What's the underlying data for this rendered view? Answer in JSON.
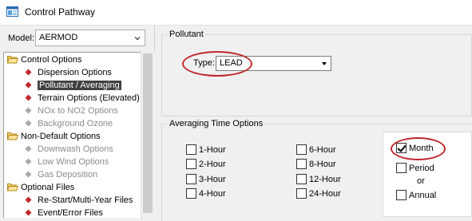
{
  "window": {
    "title": "Control Pathway",
    "icon": "app-window-icon"
  },
  "sidebar": {
    "model_label": "Model:",
    "model_value": "AERMOD",
    "tree": [
      {
        "label": "Control Options",
        "kind": "folder",
        "state": "normal"
      },
      {
        "label": "Dispersion Options",
        "kind": "item",
        "state": "normal"
      },
      {
        "label": "Pollutant / Averaging",
        "kind": "item",
        "state": "selected"
      },
      {
        "label": "Terrain Options (Elevated)",
        "kind": "item",
        "state": "normal"
      },
      {
        "label": "NOx to NO2 Options",
        "kind": "item",
        "state": "disabled"
      },
      {
        "label": "Background Ozone",
        "kind": "item",
        "state": "disabled"
      },
      {
        "label": "Non-Default Options",
        "kind": "folder",
        "state": "normal"
      },
      {
        "label": "Downwash Options",
        "kind": "item",
        "state": "disabled"
      },
      {
        "label": "Low Wind Options",
        "kind": "item",
        "state": "disabled"
      },
      {
        "label": "Gas Deposition",
        "kind": "item",
        "state": "disabled"
      },
      {
        "label": "Optional Files",
        "kind": "folder",
        "state": "normal"
      },
      {
        "label": "Re-Start/Multi-Year Files",
        "kind": "item",
        "state": "normal"
      },
      {
        "label": "Event/Error Files",
        "kind": "item",
        "state": "normal"
      }
    ]
  },
  "pollutant": {
    "group_title": "Pollutant",
    "type_label": "Type:",
    "type_value": "LEAD"
  },
  "averaging": {
    "group_title": "Averaging Time Options",
    "options": [
      {
        "label": "1-Hour",
        "checked": false
      },
      {
        "label": "2-Hour",
        "checked": false
      },
      {
        "label": "3-Hour",
        "checked": false
      },
      {
        "label": "4-Hour",
        "checked": false
      },
      {
        "label": "6-Hour",
        "checked": false
      },
      {
        "label": "8-Hour",
        "checked": false
      },
      {
        "label": "12-Hour",
        "checked": false
      },
      {
        "label": "24-Hour",
        "checked": false
      }
    ],
    "month": {
      "label": "Month",
      "checked": true
    },
    "period": {
      "label": "Period",
      "checked": false
    },
    "or_text": "or",
    "annual": {
      "label": "Annual",
      "checked": false
    }
  },
  "colors": {
    "highlight_ellipse": "#c0282d",
    "selection_bg": "#414141",
    "bullet_red": "#c0282d"
  }
}
